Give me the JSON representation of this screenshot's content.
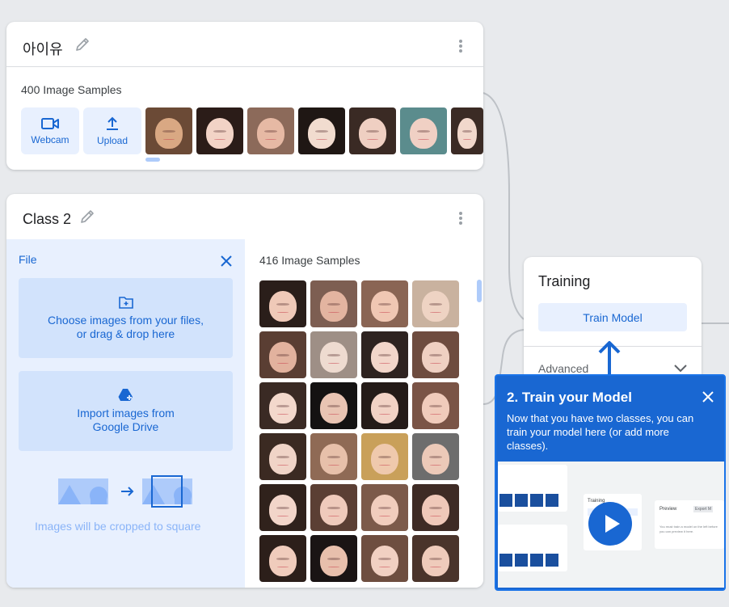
{
  "class1": {
    "title": "아이유",
    "samples_label": "400 Image Samples",
    "webcam_label": "Webcam",
    "upload_label": "Upload"
  },
  "class2": {
    "title": "Class 2",
    "file_label": "File",
    "choose_files_line1": "Choose images from your files,",
    "choose_files_line2": "or drag & drop here",
    "import_line1": "Import images from",
    "import_line2": "Google Drive",
    "crop_note": "Images will be cropped to square",
    "samples_label": "416 Image Samples"
  },
  "training": {
    "title": "Training",
    "train_button": "Train Model",
    "advanced_label": "Advanced"
  },
  "tooltip": {
    "title": "2. Train your Model",
    "body": "Now that you have two classes, you can train your model here (or add more classes).",
    "video": {
      "training_label": "Training",
      "preview_label": "Preview",
      "export_label": "Export M",
      "preview_note": "You must train a model on the left before you can preview it here."
    }
  },
  "colors": {
    "accent": "#1967d2",
    "accent_light": "#e8f0fe",
    "background": "#e8eaed"
  }
}
